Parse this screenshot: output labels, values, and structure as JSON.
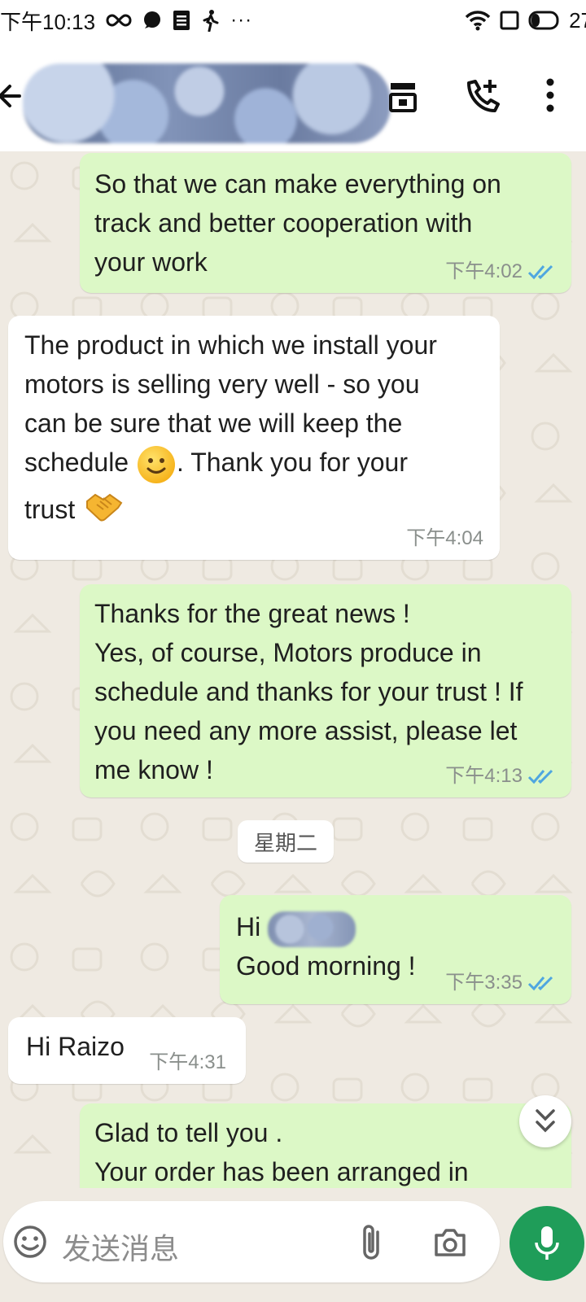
{
  "status_bar": {
    "time": "下午10:13",
    "battery": "27"
  },
  "header": {
    "contact_name": "",
    "icons": [
      "back-arrow-icon",
      "video-call-icon",
      "add-call-icon",
      "more-vertical-icon"
    ]
  },
  "messages": [
    {
      "direction": "outgoing",
      "text": "So that we can make everything on\ntrack and better cooperation with\nyour work",
      "time": "下午4:02",
      "status": "read"
    },
    {
      "direction": "incoming",
      "text_part1": "The product in which we install your\nmotors is selling very well - so you\ncan be sure that we will keep the\nschedule ",
      "text_part2": ". Thank you for your",
      "text_part3": "trust ",
      "time": "下午4:04",
      "emojis": [
        "smiling-face",
        "handshake"
      ]
    },
    {
      "direction": "outgoing",
      "text": "Thanks for the great news !\nYes, of course, Motors produce in\nschedule and thanks for your trust ! If\nyou need any more assist, please let\nme know !",
      "time": "下午4:13",
      "status": "read"
    },
    {
      "direction": "outgoing",
      "text_greeting": "Hi ",
      "text_line2": "Good morning !",
      "time": "下午3:35",
      "status": "read"
    },
    {
      "direction": "incoming",
      "text": "Hi Raizo",
      "time": "下午4:31"
    },
    {
      "direction": "outgoing",
      "text": "Glad to tell you .",
      "text_partial": "Your order has been arranged in"
    }
  ],
  "date_divider": "星期二",
  "composer": {
    "placeholder": "发送消息"
  },
  "colors": {
    "outgoing_bubble": "#dcf8c6",
    "incoming_bubble": "#ffffff",
    "chat_background": "#efeae2",
    "accent_green": "#1f9d59",
    "read_ticks": "#4fa6e0"
  }
}
